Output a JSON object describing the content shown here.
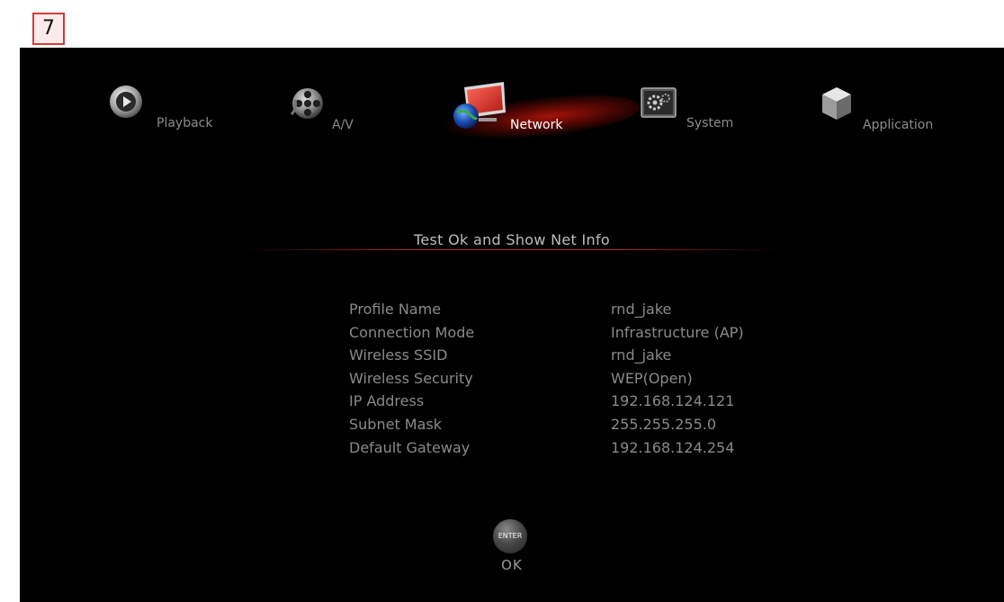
{
  "step_badge": "7",
  "menu": {
    "items": [
      {
        "label": "Playback",
        "icon": "playback-icon"
      },
      {
        "label": "A/V",
        "icon": "av-film-reel-icon"
      },
      {
        "label": "Network",
        "icon": "network-globe-icon",
        "active": true
      },
      {
        "label": "System",
        "icon": "system-gear-icon"
      },
      {
        "label": "Application",
        "icon": "application-cube-icon"
      }
    ]
  },
  "dialog": {
    "title": "Test Ok and Show Net Info",
    "rows": [
      {
        "label": "Profile Name",
        "value": "rnd_jake"
      },
      {
        "label": "Connection Mode",
        "value": "Infrastructure (AP)"
      },
      {
        "label": "Wireless SSID",
        "value": "rnd_jake"
      },
      {
        "label": "Wireless Security",
        "value": "WEP(Open)"
      },
      {
        "label": "IP Address",
        "value": "192.168.124.121"
      },
      {
        "label": "Subnet Mask",
        "value": "255.255.255.0"
      },
      {
        "label": "Default Gateway",
        "value": "192.168.124.254"
      }
    ]
  },
  "enter_button": {
    "label": "ENTER",
    "caption": "OK"
  },
  "colors": {
    "background": "#000000",
    "accent": "#c8281e",
    "text": "#8a8a8a",
    "active_text": "#ffffff"
  }
}
